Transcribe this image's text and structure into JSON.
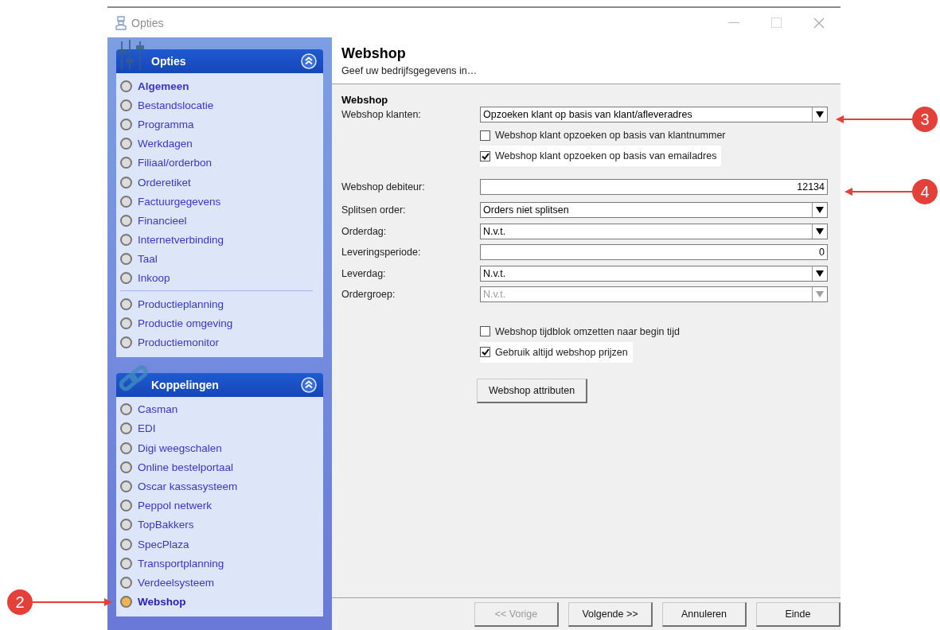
{
  "window": {
    "title": "Opties"
  },
  "sidebar": {
    "groups": [
      {
        "title": "Opties",
        "items": [
          {
            "label": "Algemeen",
            "selected": false,
            "bold": true
          },
          {
            "label": "Bestandslocatie",
            "selected": false,
            "bold": false
          },
          {
            "label": "Programma",
            "selected": false,
            "bold": false
          },
          {
            "label": "Werkdagen",
            "selected": false,
            "bold": false
          },
          {
            "label": "Filiaal/orderbon",
            "selected": false,
            "bold": false
          },
          {
            "label": "Orderetiket",
            "selected": false,
            "bold": false
          },
          {
            "label": "Factuurgegevens",
            "selected": false,
            "bold": false
          },
          {
            "label": "Financieel",
            "selected": false,
            "bold": false
          },
          {
            "label": "Internetverbinding",
            "selected": false,
            "bold": false
          },
          {
            "label": "Taal",
            "selected": false,
            "bold": false
          },
          {
            "label": "Inkoop",
            "selected": false,
            "bold": false
          },
          {
            "kind": "divider"
          },
          {
            "label": "Productieplanning",
            "selected": false,
            "bold": false
          },
          {
            "label": "Productie omgeving",
            "selected": false,
            "bold": false
          },
          {
            "label": "Productiemonitor",
            "selected": false,
            "bold": false
          }
        ]
      },
      {
        "title": "Koppelingen",
        "items": [
          {
            "label": "Casman",
            "selected": false,
            "bold": false
          },
          {
            "label": "EDI",
            "selected": false,
            "bold": false
          },
          {
            "label": "Digi weegschalen",
            "selected": false,
            "bold": false
          },
          {
            "label": "Online bestelportaal",
            "selected": false,
            "bold": false
          },
          {
            "label": "Oscar kassasysteem",
            "selected": false,
            "bold": false
          },
          {
            "label": "Peppol netwerk",
            "selected": false,
            "bold": false
          },
          {
            "label": "TopBakkers",
            "selected": false,
            "bold": false
          },
          {
            "label": "SpecPlaza",
            "selected": false,
            "bold": false
          },
          {
            "label": "Transportplanning",
            "selected": false,
            "bold": false
          },
          {
            "label": "Verdeelsysteem",
            "selected": false,
            "bold": false
          },
          {
            "label": "Webshop",
            "selected": true,
            "bold": true
          }
        ]
      }
    ]
  },
  "header": {
    "title": "Webshop",
    "subtitle": "Geef uw bedrijfsgegevens in…"
  },
  "section": {
    "title": "Webshop",
    "customer_lookup": {
      "label": "Webshop klanten:",
      "kind": "select",
      "value": "Opzoeken klant op basis van klant/afleveradres",
      "disabled": false
    },
    "lookup_options": [
      {
        "label": "Webshop klant opzoeken op basis van klantnummer",
        "checked": false
      },
      {
        "label": "Webshop klant opzoeken op basis van emailadres",
        "checked": true
      }
    ],
    "fields": [
      {
        "label": "Webshop debiteur:",
        "kind": "input",
        "value": "12134",
        "disabled": false
      },
      {
        "label": "Splitsen order:",
        "kind": "select",
        "value": "Orders niet splitsen",
        "disabled": false
      },
      {
        "label": "Orderdag:",
        "kind": "select",
        "value": "N.v.t.",
        "disabled": false
      },
      {
        "label": "Leveringsperiode:",
        "kind": "input",
        "value": "0",
        "disabled": false
      },
      {
        "label": "Leverdag:",
        "kind": "select",
        "value": "N.v.t.",
        "disabled": false
      },
      {
        "label": "Ordergroep:",
        "kind": "select",
        "value": "N.v.t.",
        "disabled": true
      }
    ],
    "options": [
      {
        "label": "Webshop tijdblok omzetten naar begin tijd",
        "checked": false
      },
      {
        "label": "Gebruik altijd webshop prijzen",
        "checked": true
      }
    ],
    "button": "Webshop attributen"
  },
  "footer": {
    "buttons": [
      {
        "label": "<< Vorige",
        "disabled": true
      },
      {
        "label": "Volgende >>",
        "disabled": false
      },
      {
        "label": "Annuleren",
        "disabled": false
      },
      {
        "label": "Einde",
        "disabled": false
      }
    ]
  },
  "callouts": [
    {
      "label": "2"
    },
    {
      "label": "3"
    },
    {
      "label": "4"
    }
  ]
}
